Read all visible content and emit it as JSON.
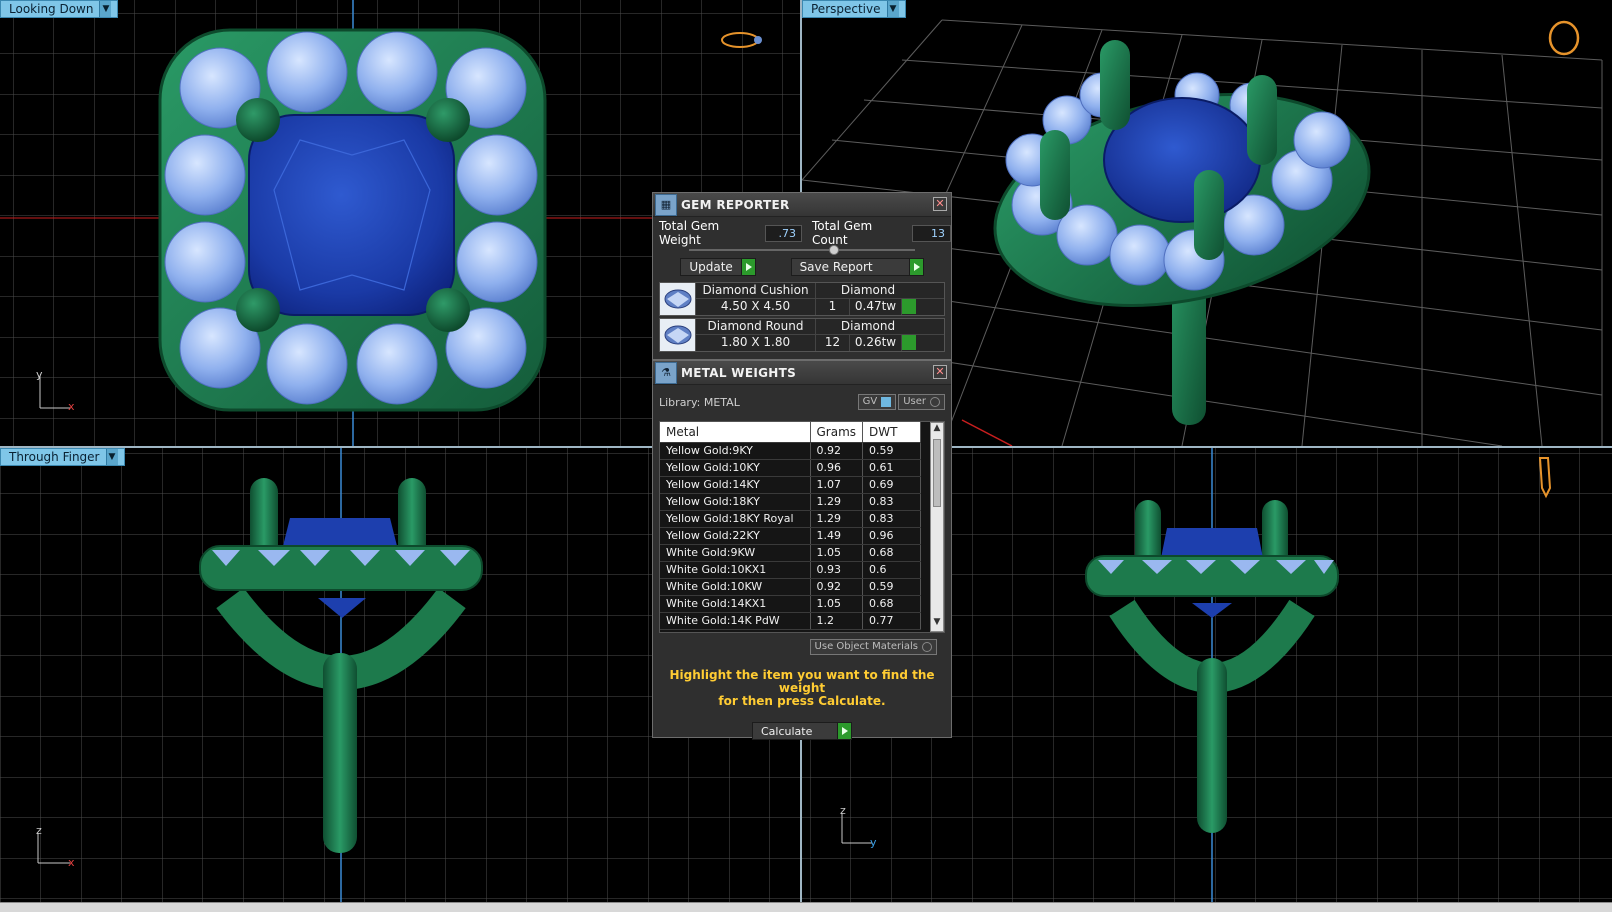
{
  "viewports": {
    "top_left": {
      "label": "Looking Down",
      "axis_a": "y",
      "axis_b": "x"
    },
    "top_right": {
      "label": "Perspective"
    },
    "bottom_left": {
      "label": "Through Finger",
      "axis_a": "z",
      "axis_b": "x"
    },
    "bottom_right": {
      "axis_a": "z",
      "axis_b": "y"
    }
  },
  "gem_reporter": {
    "title": "GEM REPORTER",
    "total_weight_label": "Total Gem Weight",
    "total_weight_value": ".73",
    "total_count_label": "Total Gem Count",
    "total_count_value": "13",
    "update_label": "Update",
    "save_label": "Save Report",
    "gems": [
      {
        "name": "Diamond Cushion",
        "material": "Diamond",
        "size": "4.50 X 4.50",
        "count": "1",
        "weight": "0.47tw"
      },
      {
        "name": "Diamond Round",
        "material": "Diamond",
        "size": "1.80 X 1.80",
        "count": "12",
        "weight": "0.26tw"
      }
    ]
  },
  "metal_weights": {
    "title": "METAL WEIGHTS",
    "library_label": "Library: METAL",
    "gv_label": "GV",
    "user_label": "User",
    "columns": [
      "Metal",
      "Grams",
      "DWT"
    ],
    "rows": [
      [
        "Yellow Gold:9KY",
        "0.92",
        "0.59"
      ],
      [
        "Yellow Gold:10KY",
        "0.96",
        "0.61"
      ],
      [
        "Yellow Gold:14KY",
        "1.07",
        "0.69"
      ],
      [
        "Yellow Gold:18KY",
        "1.29",
        "0.83"
      ],
      [
        "Yellow Gold:18KY Royal",
        "1.29",
        "0.83"
      ],
      [
        "Yellow Gold:22KY",
        "1.49",
        "0.96"
      ],
      [
        "White Gold:9KW",
        "1.05",
        "0.68"
      ],
      [
        "White Gold:10KX1",
        "0.93",
        "0.6"
      ],
      [
        "White Gold:10KW",
        "0.92",
        "0.59"
      ],
      [
        "White Gold:14KX1",
        "1.05",
        "0.68"
      ],
      [
        "White Gold:14K PdW",
        "1.2",
        "0.77"
      ]
    ],
    "use_object_materials": "Use Object Materials",
    "hint_line1": "Highlight the item you want to find the weight",
    "hint_line2": "for then press Calculate.",
    "calculate_label": "Calculate"
  },
  "colors": {
    "grid": "#5a5a5a",
    "axis_red": "#c81e1e",
    "axis_blue": "#3a8bd6",
    "metal": "#1f7a4e",
    "sapphire": "#1d3fae",
    "diamond": "#9ab8f0"
  }
}
